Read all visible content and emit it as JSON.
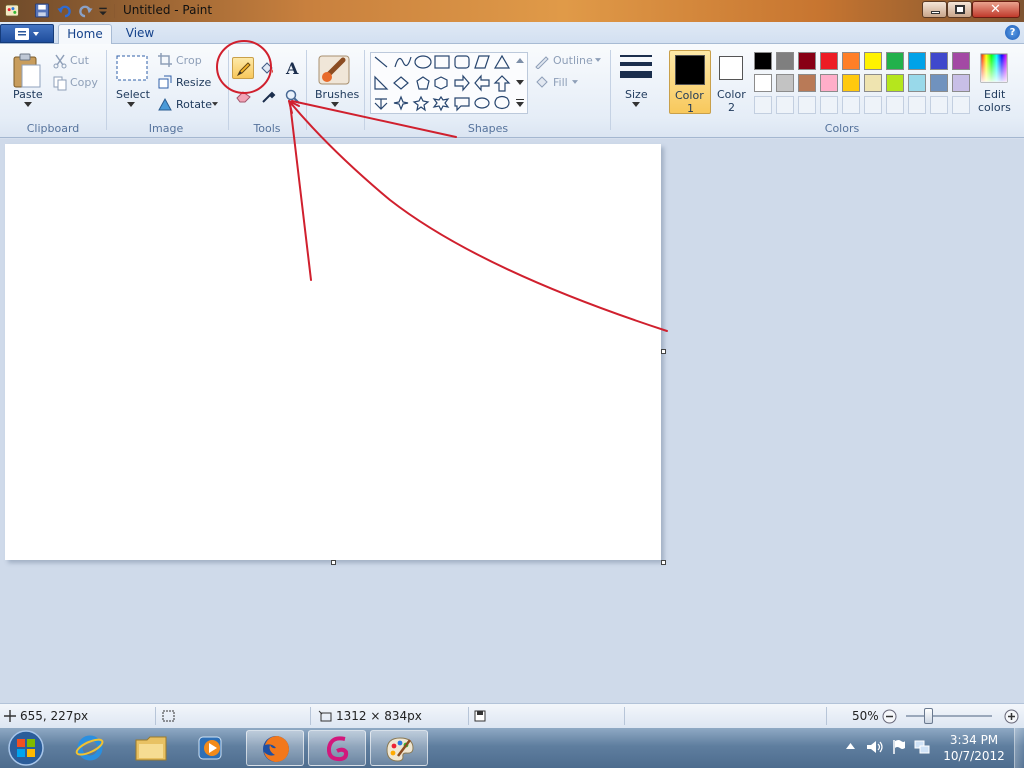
{
  "window": {
    "title": "Untitled - Paint"
  },
  "tabs": [
    "Home",
    "View"
  ],
  "help": "?",
  "clipboard": {
    "paste": "Paste",
    "cut": "Cut",
    "copy": "Copy",
    "group": "Clipboard"
  },
  "image": {
    "select": "Select",
    "crop": "Crop",
    "resize": "Resize",
    "rotate": "Rotate",
    "group": "Image"
  },
  "tools": {
    "group": "Tools",
    "text_glyph": "A"
  },
  "brushes": {
    "label": "Brushes"
  },
  "shapes": {
    "outline": "Outline",
    "fill": "Fill",
    "group": "Shapes"
  },
  "size": {
    "label": "Size"
  },
  "color1": {
    "label": "Color",
    "num": "1",
    "value": "#000000"
  },
  "color2": {
    "label": "Color",
    "num": "2",
    "value": "#ffffff"
  },
  "colors": {
    "group": "Colors",
    "edit_label": "Edit",
    "edit_label2": "colors",
    "row1": [
      "#000000",
      "#7f7f7f",
      "#880015",
      "#ed1c24",
      "#ff7f27",
      "#fff200",
      "#22b14c",
      "#00a2e8",
      "#3f48cc",
      "#a349a4"
    ],
    "row2": [
      "#ffffff",
      "#c3c3c3",
      "#b97a57",
      "#ffaec9",
      "#ffc90e",
      "#efe4b0",
      "#b5e61d",
      "#99d9ea",
      "#7092be",
      "#c8bfe7"
    ]
  },
  "status": {
    "cursor_pos": "655, 227px",
    "image_size": "1312 × 834px",
    "zoom": "50%"
  },
  "taskbar": {
    "time": "3:34 PM",
    "date": "10/7/2012"
  },
  "annotation_color": "#d0202e"
}
